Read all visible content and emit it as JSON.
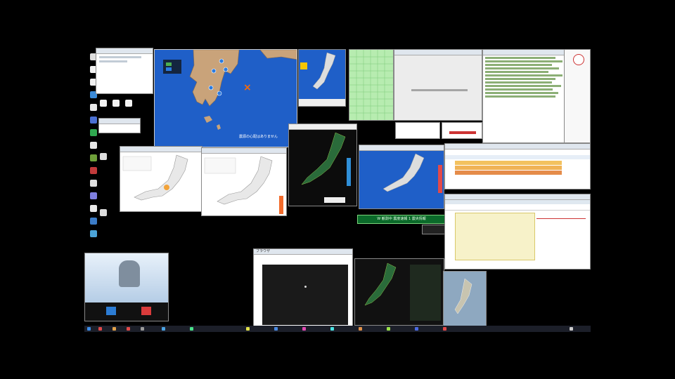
{
  "eq_map": {
    "message": "震源の心配はありません",
    "legend_label": "震度"
  },
  "banner": {
    "text": "W 観測中 震度速報 1 震央情報"
  },
  "browser": {
    "title": "ブラウザ"
  },
  "colors": {
    "sea": "#1f5fc8",
    "desktop": "#000000",
    "taskbar": "#1c1f29",
    "epicenter": "#ff6a00",
    "banner_bg": "#0b6a2a"
  },
  "icons": [
    "recycle-bin-icon",
    "document-icon",
    "document-icon",
    "folder-icon",
    "app-icon",
    "app-icon",
    "app-icon",
    "app-icon",
    "app-icon",
    "app-icon",
    "app-icon",
    "app-icon",
    "app-icon",
    "app-icon",
    "app-icon"
  ]
}
